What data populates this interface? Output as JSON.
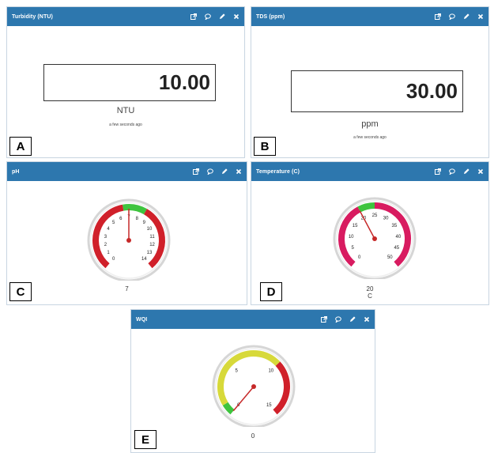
{
  "colors": {
    "header": "#2d77ae",
    "gauge_red": "#d0202a",
    "gauge_green": "#3ec43e",
    "gauge_yellow": "#d7d93a",
    "gauge_pink": "#d81b60",
    "needle": "#c62828"
  },
  "icons": [
    "external-link-icon",
    "comment-icon",
    "pencil-icon",
    "close-icon"
  ],
  "panels": {
    "turbidity": {
      "title": "Turbidity (NTU)",
      "value": "10.00",
      "unit": "NTU",
      "timestamp": "a few seconds ago",
      "letter": "A"
    },
    "tds": {
      "title": "TDS (ppm)",
      "value": "30.00",
      "unit": "ppm",
      "timestamp": "a few seconds ago",
      "letter": "B"
    },
    "ph": {
      "title": "pH",
      "value": "7",
      "letter": "C",
      "min": 0,
      "max": 14,
      "needle_value": 7,
      "ticks": [
        "0",
        "1",
        "2",
        "3",
        "4",
        "5",
        "6",
        "7",
        "8",
        "9",
        "10",
        "11",
        "12",
        "13",
        "14"
      ],
      "bands": [
        {
          "from": 0,
          "to": 6.5,
          "color": "#d0202a"
        },
        {
          "from": 6.5,
          "to": 8.5,
          "color": "#3ec43e"
        },
        {
          "from": 8.5,
          "to": 14,
          "color": "#d0202a"
        }
      ]
    },
    "temperature": {
      "title": "Temperature (C)",
      "value": "20",
      "unit": "C",
      "letter": "D",
      "min": 0,
      "max": 50,
      "needle_value": 20,
      "ticks": [
        "0",
        "5",
        "10",
        "15",
        "20",
        "25",
        "30",
        "35",
        "40",
        "45",
        "50"
      ],
      "bands": [
        {
          "from": 0,
          "to": 20,
          "color": "#d81b60"
        },
        {
          "from": 20,
          "to": 25,
          "color": "#3ec43e"
        },
        {
          "from": 25,
          "to": 50,
          "color": "#d81b60"
        }
      ]
    },
    "wqi": {
      "title": "WQI",
      "value": "0",
      "letter": "E",
      "min": 0,
      "max": 15,
      "needle_value": 0,
      "ticks": [
        "0",
        "5",
        "10",
        "15"
      ],
      "bands": [
        {
          "from": 0,
          "to": 1,
          "color": "#3ec43e"
        },
        {
          "from": 1,
          "to": 10,
          "color": "#d7d93a"
        },
        {
          "from": 10,
          "to": 15,
          "color": "#d0202a"
        }
      ]
    }
  }
}
